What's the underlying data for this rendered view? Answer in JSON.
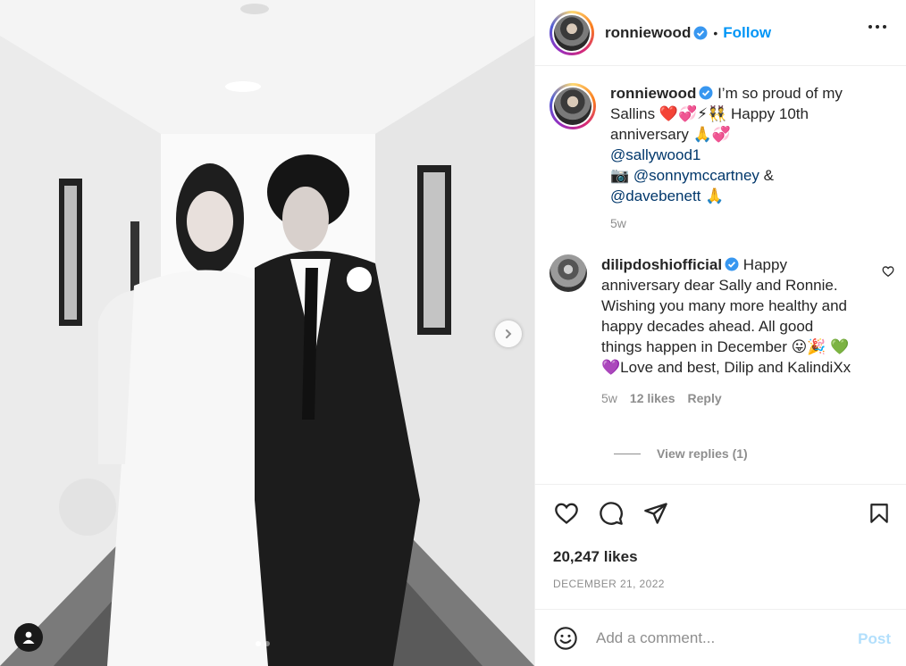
{
  "post": {
    "username": "ronniewood",
    "follow_label": "Follow",
    "separator": "•",
    "caption": {
      "username": "ronniewood",
      "line1": "I’m so proud of my",
      "line2_a": "Sallins",
      "line2_emoji": "❤️💞⚡👯",
      "line2_b": "Happy 10th",
      "line3": "anniversary",
      "line3_emoji": "🙏💞",
      "mention1": "@sallywood1",
      "camera_emoji": "📷",
      "mention2": "@sonnymccartney",
      "amp": "&",
      "mention3": "@davebenett",
      "pray_emoji": "🙏",
      "time": "5w"
    },
    "comment": {
      "username": "dilipdoshiofficial",
      "text_a": "Happy anniversary dear Sally and Ronnie. Wishing you many more healthy and happy decades ahead. All good things happen in December",
      "emoji_a": "😛🎉",
      "emoji_b": "💚💜",
      "text_b": "Love and best, Dilip and KalindiXx",
      "time": "5w",
      "likes": "12 likes",
      "reply_label": "Reply",
      "view_replies": "View replies (1)"
    },
    "likes": "20,247 likes",
    "date": "DECEMBER 21, 2022",
    "add_comment_placeholder": "Add a comment...",
    "post_button": "Post"
  },
  "icons": {
    "like": "heart-icon",
    "comment": "comment-icon",
    "share": "paper-plane-icon",
    "save": "bookmark-icon",
    "emoji": "smiley-icon",
    "more": "more-options-icon",
    "next": "chevron-right-icon",
    "tag": "user-tag-icon",
    "verified": "verified-badge-icon"
  },
  "colors": {
    "accent": "#0095f6",
    "verified": "#3897f0",
    "text": "#262626",
    "muted": "#8e8e8e",
    "post_disabled": "#b2dffc"
  }
}
